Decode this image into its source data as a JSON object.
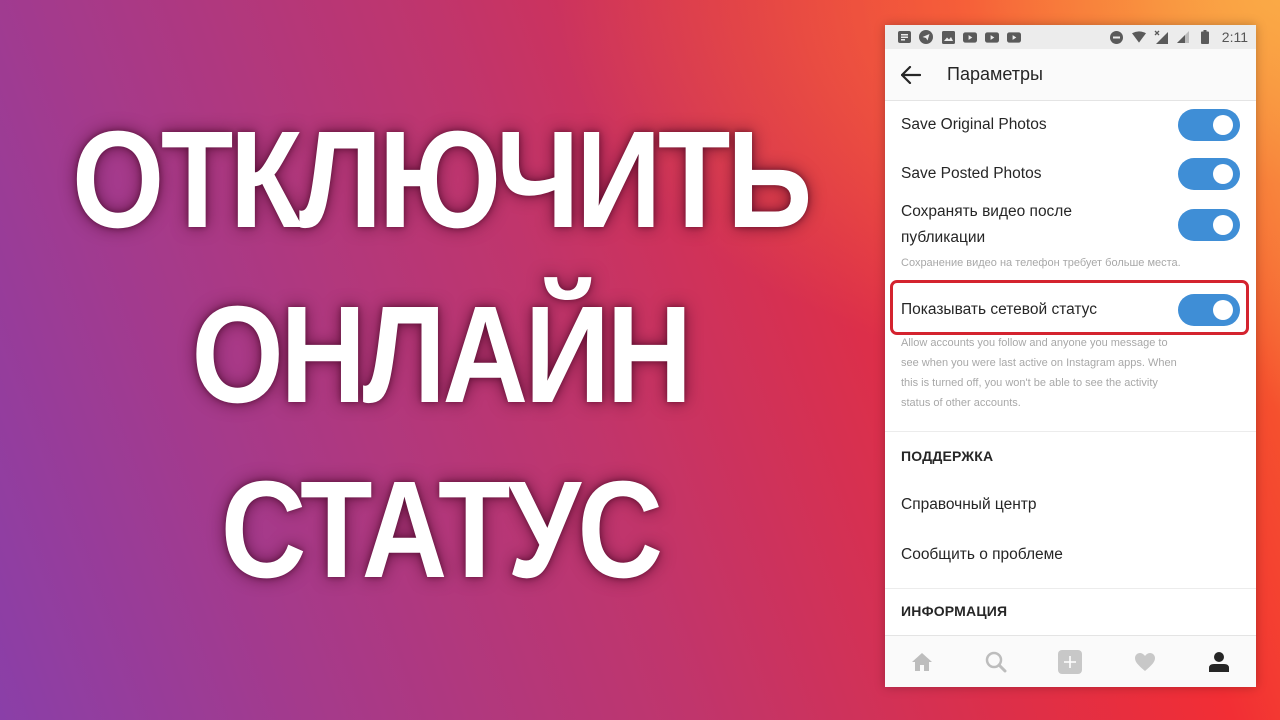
{
  "headline": {
    "lines": [
      "ОТКЛЮЧИТЬ",
      "ОНЛАЙН",
      "СТАТУС"
    ]
  },
  "phone": {
    "statusbar": {
      "left_icons": [
        "notification-list-icon",
        "telegram-icon",
        "gallery-icon",
        "youtube-icon",
        "youtube-icon",
        "youtube-icon"
      ],
      "right_icons": [
        "do-not-disturb-icon",
        "wifi-icon",
        "mobile-signal-no-data-icon",
        "signal-icon",
        "battery-icon"
      ],
      "time": "2:11"
    },
    "appbar": {
      "back_icon": "arrow-left-icon",
      "title": "Параметры"
    },
    "settings": {
      "toggles": [
        {
          "label": "Save Original Photos",
          "on": true
        },
        {
          "label": "Save Posted Photos",
          "on": true
        },
        {
          "label_line1": "Сохранять видео после",
          "label_line2": "публикации",
          "on": true,
          "hint": "Сохранение видео на телефон требует больше места."
        },
        {
          "label": "Показывать сетевой статус",
          "on": true,
          "highlighted": true,
          "hint_lines": [
            "Allow accounts you follow and anyone you message to",
            "see when you were last active on Instagram apps. When",
            "this is turned off, you won't be able to see the activity",
            "status of other accounts."
          ]
        }
      ],
      "sections": [
        {
          "header": "ПОДДЕРЖКА",
          "items": [
            "Справочный центр",
            "Сообщить о проблеме"
          ]
        },
        {
          "header": "ИНФОРМАЦИЯ",
          "items": []
        }
      ]
    },
    "bottomnav": [
      {
        "icon": "home-icon",
        "active": false
      },
      {
        "icon": "search-icon",
        "active": false
      },
      {
        "icon": "add-post-icon",
        "active": false
      },
      {
        "icon": "heart-icon",
        "active": false
      },
      {
        "icon": "profile-icon",
        "active": true
      }
    ]
  },
  "colors": {
    "toggle_on": "#3f8ed6",
    "highlight": "#d4232f",
    "headline_text": "#ffffff"
  }
}
